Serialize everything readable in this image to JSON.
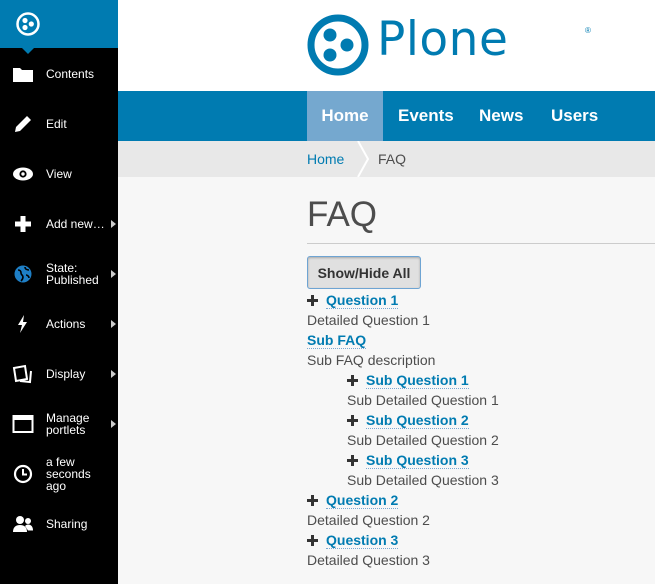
{
  "toolbar": {
    "items": [
      {
        "label": "Contents",
        "icon": "folder-icon",
        "arrow": false
      },
      {
        "label": "Edit",
        "icon": "pencil-icon",
        "arrow": false
      },
      {
        "label": "View",
        "icon": "eye-icon",
        "arrow": false
      },
      {
        "label": "Add new…",
        "icon": "plus-icon",
        "arrow": true
      },
      {
        "label": "State:\nPublished",
        "icon": "globe-icon",
        "arrow": true
      },
      {
        "label": "Actions",
        "icon": "bolt-icon",
        "arrow": true
      },
      {
        "label": "Display",
        "icon": "display-icon",
        "arrow": true
      },
      {
        "label": "Manage\nportlets",
        "icon": "window-icon",
        "arrow": true
      },
      {
        "label": "a few\nseconds\nago",
        "icon": "clock-icon",
        "arrow": false
      },
      {
        "label": "Sharing",
        "icon": "users-icon",
        "arrow": false
      }
    ]
  },
  "header": {
    "logo_text": "Plone",
    "logo_reg": "®"
  },
  "nav": {
    "items": [
      "Home",
      "Events",
      "News",
      "Users"
    ],
    "active": "Home"
  },
  "breadcrumb": {
    "home": "Home",
    "current": "FAQ"
  },
  "page": {
    "title": "FAQ",
    "show_hide": "Show/Hide All"
  },
  "faq": {
    "q1": "Question 1",
    "d1": "Detailed Question 1",
    "sub_title": "Sub FAQ",
    "sub_desc": "Sub FAQ description",
    "sq1": "Sub Question 1",
    "sd1": "Sub Detailed Question 1",
    "sq2": "Sub Question 2",
    "sd2": "Sub Detailed Question 2",
    "sq3": "Sub Question 3",
    "sd3": "Sub Detailed Question 3",
    "q2": "Question 2",
    "d2": "Detailed Question 2",
    "q3": "Question 3",
    "d3": "Detailed Question 3"
  },
  "colors": {
    "accent": "#007bb1",
    "toolbar": "#000000",
    "nav_active": "#75a8cf"
  }
}
